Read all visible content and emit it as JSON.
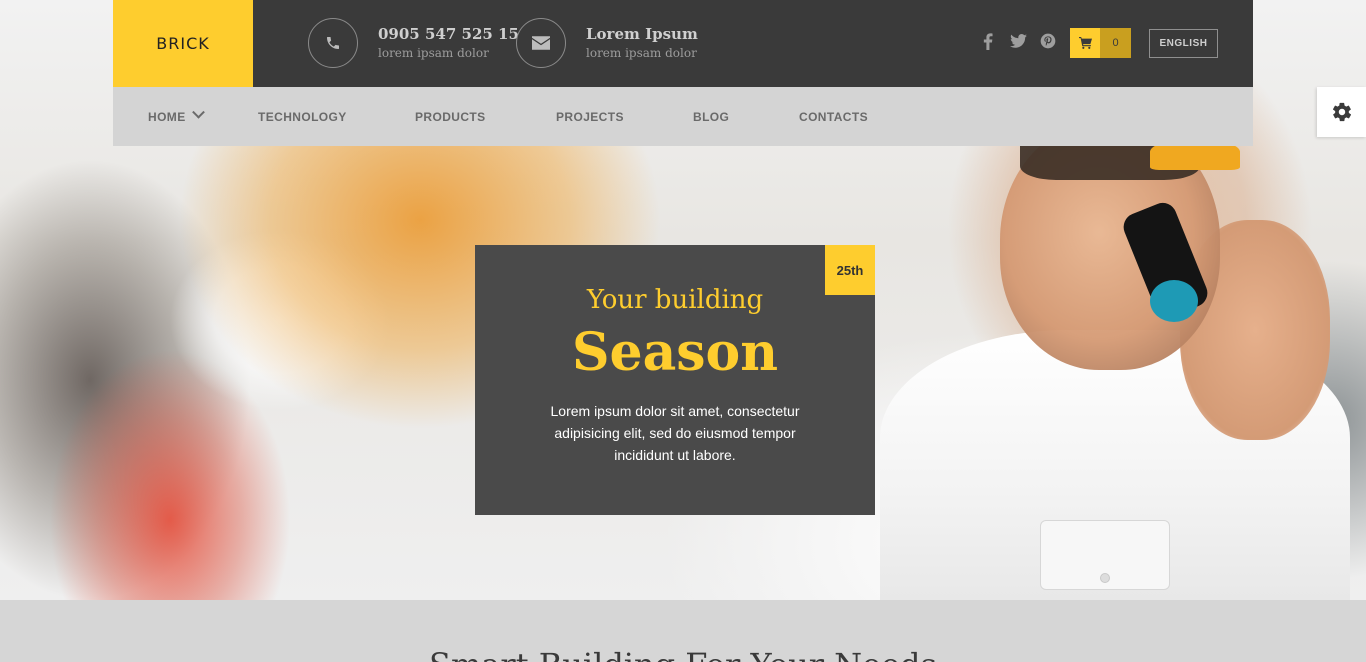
{
  "header": {
    "logo": "BRICK",
    "contacts": [
      {
        "icon": "phone-icon",
        "title": "0905 547 525 15",
        "subtitle": "lorem ipsam dolor"
      },
      {
        "icon": "envelope-icon",
        "title": "Lorem Ipsum",
        "subtitle": "lorem ipsam dolor"
      }
    ],
    "socials": [
      "facebook-icon",
      "twitter-icon",
      "pinterest-icon"
    ],
    "cart_count": "0",
    "language": "ENGLISH"
  },
  "nav": {
    "items": [
      {
        "label": "HOME"
      },
      {
        "label": "TECHNOLOGY"
      },
      {
        "label": "PRODUCTS"
      },
      {
        "label": "PROJECTS"
      },
      {
        "label": "BLOG"
      },
      {
        "label": "CONTACTS"
      }
    ]
  },
  "slide": {
    "badge": "25th",
    "subtitle": "Your building",
    "title": "Season",
    "text": "Lorem ipsum dolor sit amet, consectetur adipisicing elit, sed do eiusmod tempor incididunt ut labore."
  },
  "section": {
    "heading": "Smart Building For Your Needs"
  },
  "colors": {
    "accent": "#fecd2e",
    "topbar": "#3a3a3a",
    "nav": "#d4d4d4",
    "card": "#4a4a4a"
  }
}
